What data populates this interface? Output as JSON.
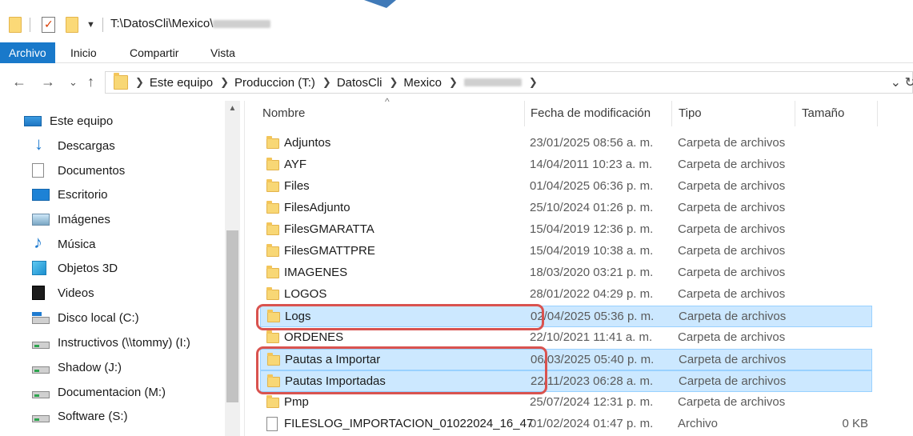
{
  "window": {
    "title_path": "T:\\DatosCli\\Mexico\\",
    "icons": [
      "folder-icon",
      "properties-check-icon",
      "new-folder-icon",
      "customize-dropdown-icon"
    ]
  },
  "ribbon": {
    "tabs": [
      {
        "label": "Archivo",
        "active": true
      },
      {
        "label": "Inicio",
        "active": false
      },
      {
        "label": "Compartir",
        "active": false
      },
      {
        "label": "Vista",
        "active": false
      }
    ],
    "accent": "#1979ca"
  },
  "address": {
    "back": "←",
    "forward": "→",
    "recent": "⌄",
    "up": "↑",
    "crumbs": [
      "Este equipo",
      "Produccion (T:)",
      "DatosCli",
      "Mexico"
    ],
    "dropdown": "⌄",
    "refresh": "↻"
  },
  "nav": {
    "items": [
      {
        "label": "Este equipo",
        "icon": "computer-icon"
      },
      {
        "label": "Descargas",
        "icon": "downloads-icon"
      },
      {
        "label": "Documentos",
        "icon": "documents-icon"
      },
      {
        "label": "Escritorio",
        "icon": "desktop-icon"
      },
      {
        "label": "Imágenes",
        "icon": "pictures-icon"
      },
      {
        "label": "Música",
        "icon": "music-icon"
      },
      {
        "label": "Objetos 3D",
        "icon": "3d-objects-icon"
      },
      {
        "label": "Videos",
        "icon": "videos-icon"
      },
      {
        "label": "Disco local (C:)",
        "icon": "local-disk-icon"
      },
      {
        "label": "Instructivos (\\\\tommy) (I:)",
        "icon": "network-drive-icon"
      },
      {
        "label": "Shadow (J:)",
        "icon": "network-drive-icon"
      },
      {
        "label": "Documentacion (M:)",
        "icon": "network-drive-icon"
      },
      {
        "label": "Software (S:)",
        "icon": "network-drive-icon"
      }
    ]
  },
  "columns": {
    "name": "Nombre",
    "date": "Fecha de modificación",
    "type": "Tipo",
    "size": "Tamaño",
    "sort_indicator": "^"
  },
  "files": [
    {
      "name": "Adjuntos",
      "date": "23/01/2025 08:56 a. m.",
      "type": "Carpeta de archivos",
      "size": "",
      "kind": "folder",
      "selected": false
    },
    {
      "name": "AYF",
      "date": "14/04/2011 10:23 a. m.",
      "type": "Carpeta de archivos",
      "size": "",
      "kind": "folder",
      "selected": false
    },
    {
      "name": "Files",
      "date": "01/04/2025 06:36 p. m.",
      "type": "Carpeta de archivos",
      "size": "",
      "kind": "folder",
      "selected": false
    },
    {
      "name": "FilesAdjunto",
      "date": "25/10/2024 01:26 p. m.",
      "type": "Carpeta de archivos",
      "size": "",
      "kind": "folder",
      "selected": false
    },
    {
      "name": "FilesGMARATTA",
      "date": "15/04/2019 12:36 p. m.",
      "type": "Carpeta de archivos",
      "size": "",
      "kind": "folder",
      "selected": false
    },
    {
      "name": "FilesGMATTPRE",
      "date": "15/04/2019 10:38 a. m.",
      "type": "Carpeta de archivos",
      "size": "",
      "kind": "folder",
      "selected": false
    },
    {
      "name": "IMAGENES",
      "date": "18/03/2020 03:21 p. m.",
      "type": "Carpeta de archivos",
      "size": "",
      "kind": "folder",
      "selected": false
    },
    {
      "name": "LOGOS",
      "date": "28/01/2022 04:29 p. m.",
      "type": "Carpeta de archivos",
      "size": "",
      "kind": "folder",
      "selected": false
    },
    {
      "name": "Logs",
      "date": "02/04/2025 05:36 p. m.",
      "type": "Carpeta de archivos",
      "size": "",
      "kind": "folder",
      "selected": true
    },
    {
      "name": "ORDENES",
      "date": "22/10/2021 11:41 a. m.",
      "type": "Carpeta de archivos",
      "size": "",
      "kind": "folder",
      "selected": false
    },
    {
      "name": "Pautas a Importar",
      "date": "06/03/2025 05:40 p. m.",
      "type": "Carpeta de archivos",
      "size": "",
      "kind": "folder",
      "selected": true
    },
    {
      "name": "Pautas Importadas",
      "date": "22/11/2023 06:28 a. m.",
      "type": "Carpeta de archivos",
      "size": "",
      "kind": "folder",
      "selected": true
    },
    {
      "name": "Pmp",
      "date": "25/07/2024 12:31 p. m.",
      "type": "Carpeta de archivos",
      "size": "",
      "kind": "folder",
      "selected": false
    },
    {
      "name": "FILESLOG_IMPORTACION_01022024_16_47",
      "date": "01/02/2024 01:47 p. m.",
      "type": "Archivo",
      "size": "0 KB",
      "kind": "file",
      "selected": false
    }
  ],
  "colors": {
    "selection_bg": "#cce8ff",
    "selection_border": "#99d1ff",
    "annotation": "#d9534f",
    "folder": "#f8d775"
  }
}
